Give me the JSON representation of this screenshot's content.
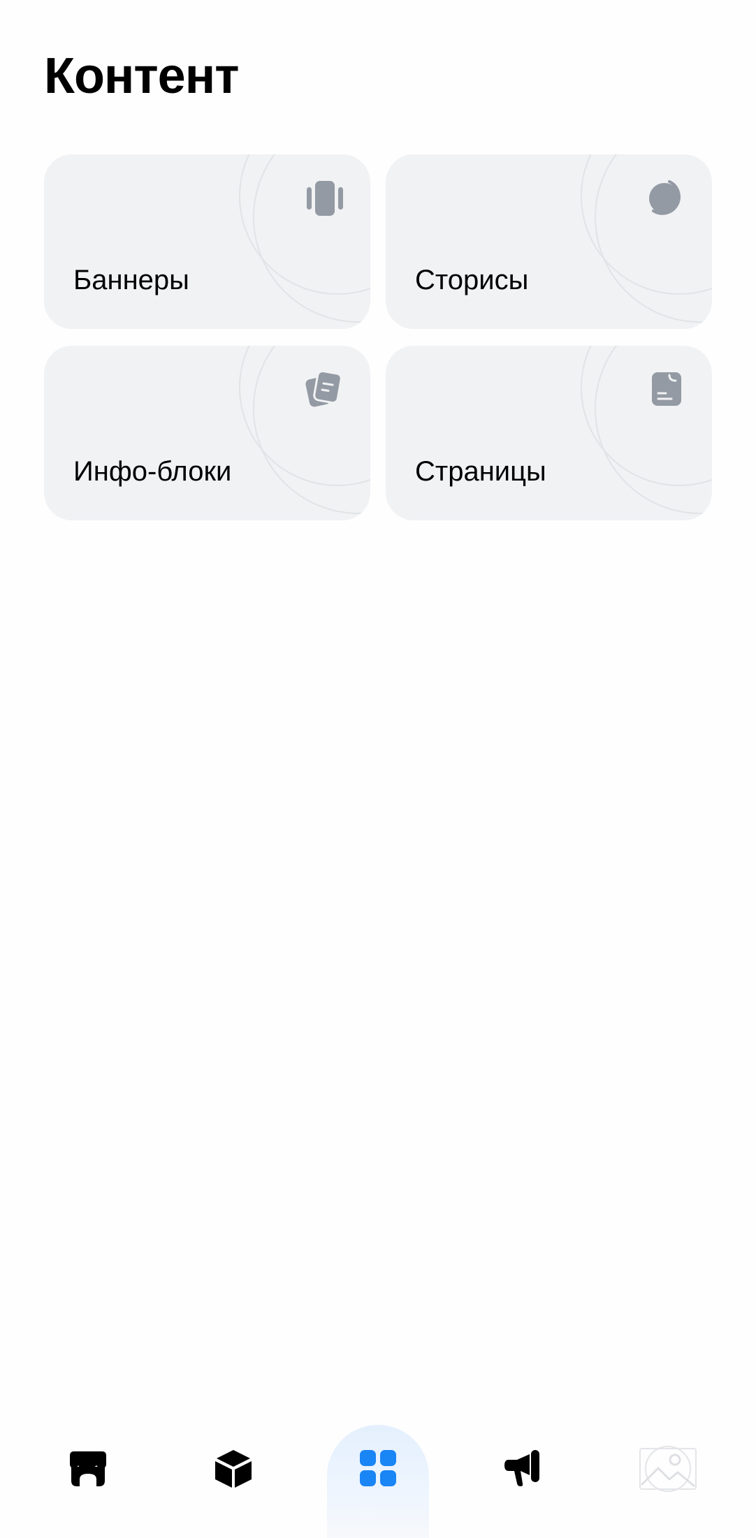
{
  "header": {
    "title": "Контент"
  },
  "cards": [
    {
      "label": "Баннеры",
      "icon": "banner-carousel-icon"
    },
    {
      "label": "Сторисы",
      "icon": "stories-circle-icon"
    },
    {
      "label": "Инфо-блоки",
      "icon": "info-blocks-icon"
    },
    {
      "label": "Страницы",
      "icon": "page-document-icon"
    }
  ],
  "bottom_nav": {
    "items": [
      {
        "icon": "storefront-icon"
      },
      {
        "icon": "box-icon"
      },
      {
        "icon": "grid-apps-icon",
        "active": true
      },
      {
        "icon": "megaphone-icon"
      },
      {
        "icon": "image-placeholder-icon"
      }
    ]
  },
  "colors": {
    "card_bg": "#f1f2f4",
    "card_icon": "#939aa3",
    "accent": "#1a85f5",
    "active_tab_bg": "#e4f0fd"
  }
}
